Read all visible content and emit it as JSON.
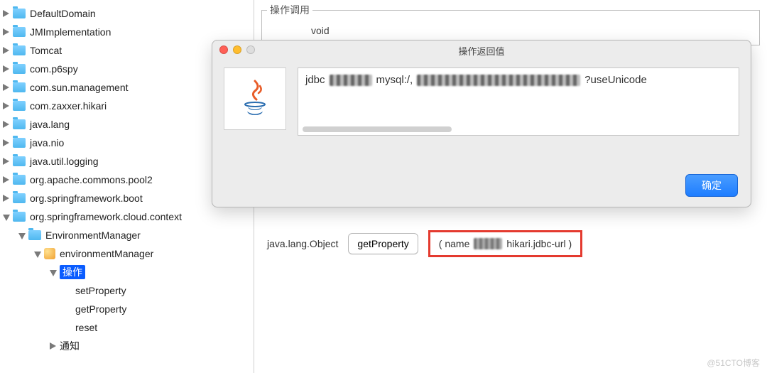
{
  "tree": {
    "items": [
      "DefaultDomain",
      "JMImplementation",
      "Tomcat",
      "com.p6spy",
      "com.sun.management",
      "com.zaxxer.hikari",
      "java.lang",
      "java.nio",
      "java.util.logging",
      "org.apache.commons.pool2",
      "org.springframework.boot",
      "org.springframework.cloud.context"
    ],
    "expanded": {
      "env_mgr_type": "EnvironmentManager",
      "env_mgr_bean": "environmentManager",
      "ops": "操作",
      "op1": "setProperty",
      "op2": "getProperty",
      "op3": "reset",
      "notify": "通知"
    }
  },
  "main": {
    "section_title": "操作调用",
    "void_label": "void",
    "return_type": "java.lang.Object",
    "button_label": "getProperty",
    "param_prefix": "( name",
    "param_suffix": "hikari.jdbc-url   )"
  },
  "dialog": {
    "title": "操作返回值",
    "result_prefix": "jdbc",
    "result_mid": "mysql:/,",
    "result_suffix": "?useUnicode",
    "ok": "确定"
  },
  "watermark": "@51CTO博客"
}
